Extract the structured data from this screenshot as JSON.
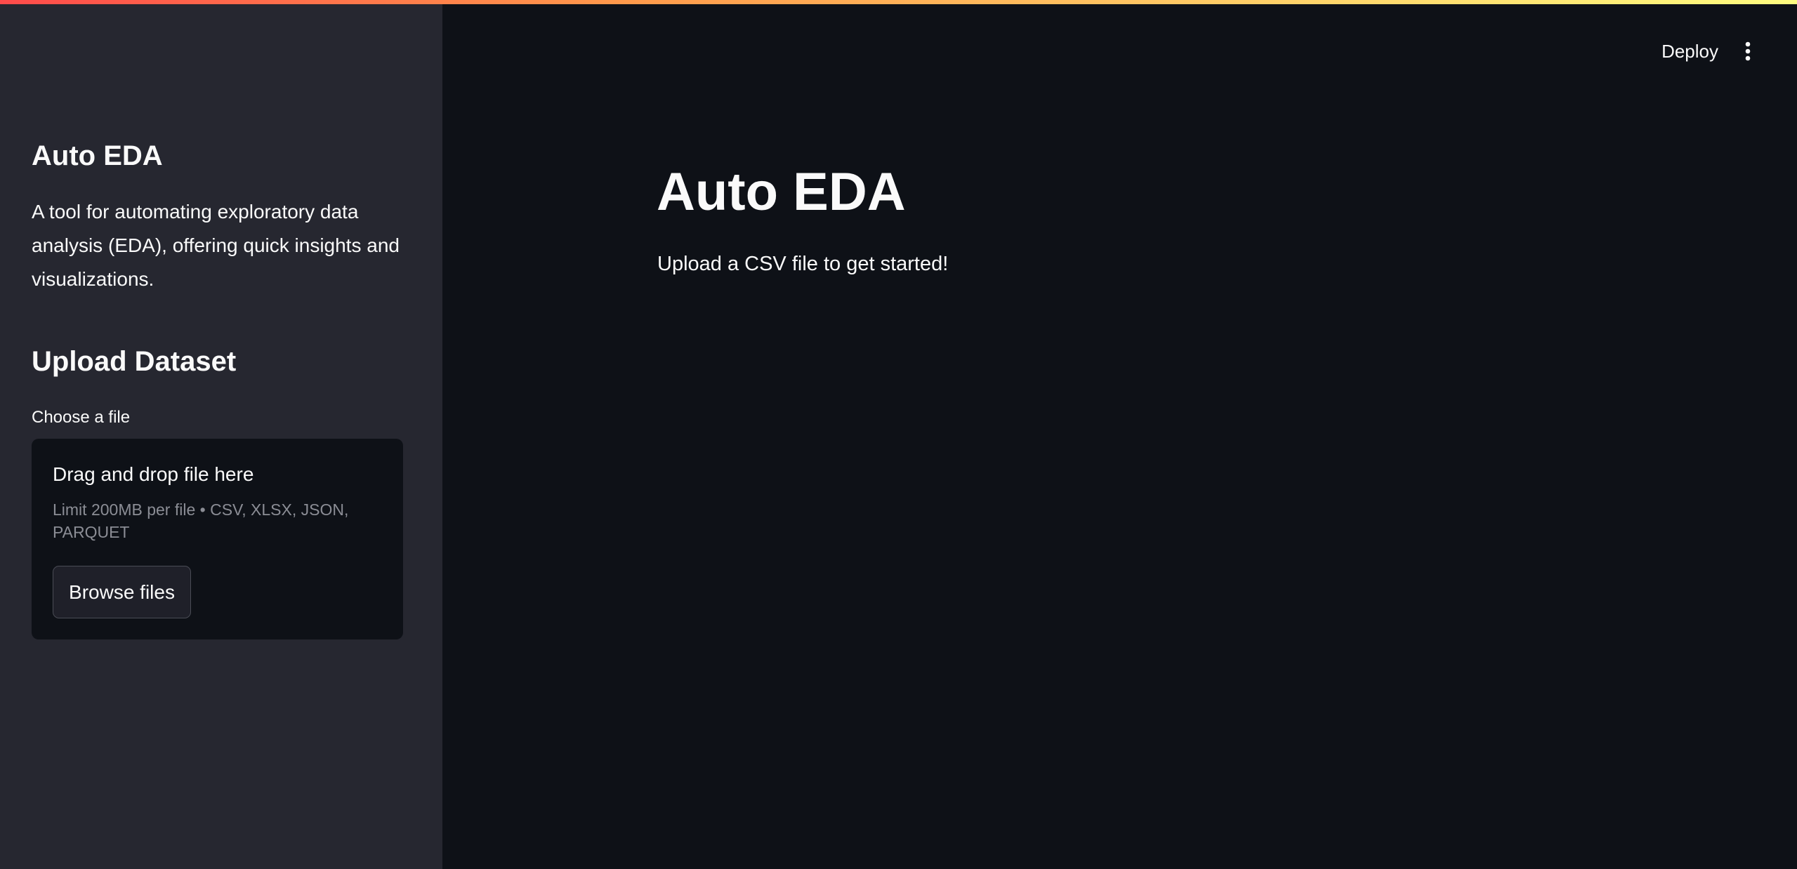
{
  "sidebar": {
    "title": "Auto EDA",
    "description": "A tool for automating exploratory data analysis (EDA), offering quick insights and visualizations.",
    "upload_heading": "Upload Dataset",
    "uploader": {
      "label": "Choose a file",
      "drop_text": "Drag and drop file here",
      "limit_text": "Limit 200MB per file • CSV, XLSX, JSON, PARQUET",
      "browse_label": "Browse files"
    }
  },
  "header": {
    "deploy_label": "Deploy",
    "menu_icon": "vertical-ellipsis-icon"
  },
  "main": {
    "title": "Auto EDA",
    "subtitle": "Upload a CSV file to get started!"
  },
  "colors": {
    "sidebar_bg": "#262730",
    "main_bg": "#0e1117",
    "text": "#fafafa",
    "muted_text": "#8b8d95",
    "accent_gradient_start": "#ff4b4b",
    "accent_gradient_end": "#fffd80"
  }
}
